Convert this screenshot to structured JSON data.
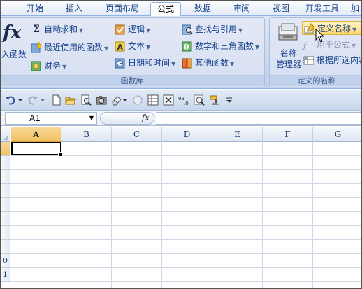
{
  "tabs": [
    "开始",
    "插入",
    "页面布局",
    "公式",
    "数据",
    "审阅",
    "视图",
    "开发工具",
    "加"
  ],
  "active_tab": "公式",
  "function_library": {
    "insert_function_label": "入函数",
    "autosum": "自动求和",
    "recent": "最近使用的函数",
    "financial": "财务",
    "logical": "逻辑",
    "text": "文本",
    "datetime": "日期和时间",
    "lookup": "查找与引用",
    "math": "数学和三角函数",
    "other": "其他函数",
    "group_label": "函数库",
    "sigma": "Σ"
  },
  "defined_names": {
    "name_manager_line1": "名称",
    "name_manager_line2": "管理器",
    "define_name": "定义名称",
    "use_in_formula": "用于公式",
    "create_from_selection": "根据所选内容",
    "group_label": "定义的名称"
  },
  "formula_bar": {
    "name_box": "A1",
    "fx_label": "fx",
    "formula_value": ""
  },
  "grid": {
    "columns": [
      "A",
      "B",
      "C",
      "D",
      "E",
      "F",
      "G"
    ],
    "active_column": "A",
    "row_labels": [
      "",
      "",
      "",
      "",
      "",
      "",
      "",
      "",
      "0",
      "1"
    ]
  },
  "colors": {
    "ribbon_bg": "#c9d5ed",
    "tab_text": "#15428b",
    "active_header": "#f1c15f",
    "highlight_button": "#ffd76a"
  }
}
